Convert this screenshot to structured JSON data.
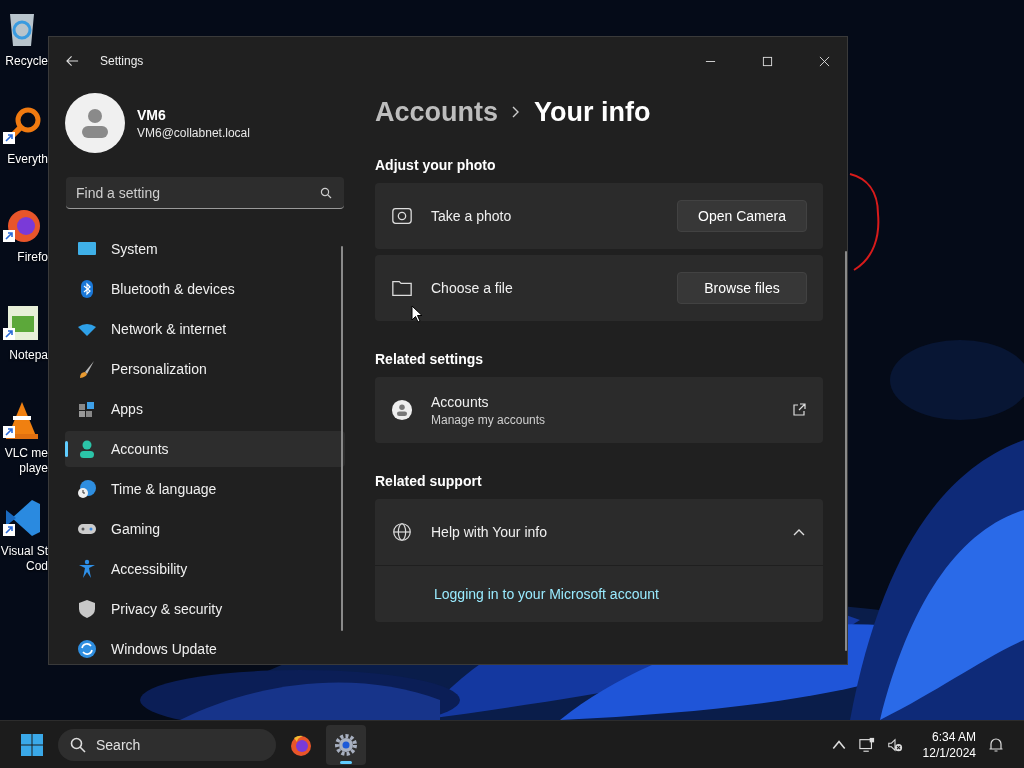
{
  "desktop_icons": [
    {
      "lines": [
        "Recycle"
      ],
      "shortcut": false
    },
    {
      "lines": [
        "Everyth"
      ],
      "shortcut": true
    },
    {
      "lines": [
        "Firefo"
      ],
      "shortcut": true
    },
    {
      "lines": [
        "Notepa"
      ],
      "shortcut": true
    },
    {
      "lines": [
        "VLC me",
        "playe"
      ],
      "shortcut": true
    },
    {
      "lines": [
        "Visual St",
        "Cod"
      ],
      "shortcut": true
    }
  ],
  "window": {
    "title": "Settings"
  },
  "account": {
    "name": "VM6",
    "email": "VM6@collabnet.local"
  },
  "search": {
    "placeholder": "Find a setting"
  },
  "nav": [
    {
      "label": "System",
      "selected": false
    },
    {
      "label": "Bluetooth & devices",
      "selected": false
    },
    {
      "label": "Network & internet",
      "selected": false
    },
    {
      "label": "Personalization",
      "selected": false
    },
    {
      "label": "Apps",
      "selected": false
    },
    {
      "label": "Accounts",
      "selected": true
    },
    {
      "label": "Time & language",
      "selected": false
    },
    {
      "label": "Gaming",
      "selected": false
    },
    {
      "label": "Accessibility",
      "selected": false
    },
    {
      "label": "Privacy & security",
      "selected": false
    },
    {
      "label": "Windows Update",
      "selected": false
    }
  ],
  "breadcrumb": {
    "parent": "Accounts",
    "current": "Your info"
  },
  "sections": [
    {
      "heading": "Adjust your photo",
      "cards": [
        {
          "kind": "action",
          "title": "Take a photo",
          "button": "Open Camera"
        },
        {
          "kind": "action",
          "title": "Choose a file",
          "button": "Browse files"
        }
      ]
    },
    {
      "heading": "Related settings",
      "cards": [
        {
          "kind": "link",
          "title": "Accounts",
          "subtitle": "Manage my accounts"
        }
      ]
    },
    {
      "heading": "Related support",
      "cards": [
        {
          "kind": "expander",
          "title": "Help with Your info",
          "expanded": true,
          "links": [
            "Logging in to your Microsoft account"
          ]
        }
      ]
    }
  ],
  "taskbar": {
    "search": "Search",
    "apps": [
      {
        "running": false
      },
      {
        "running": true
      }
    ],
    "time": "6:34 AM",
    "date": "12/1/2024"
  }
}
